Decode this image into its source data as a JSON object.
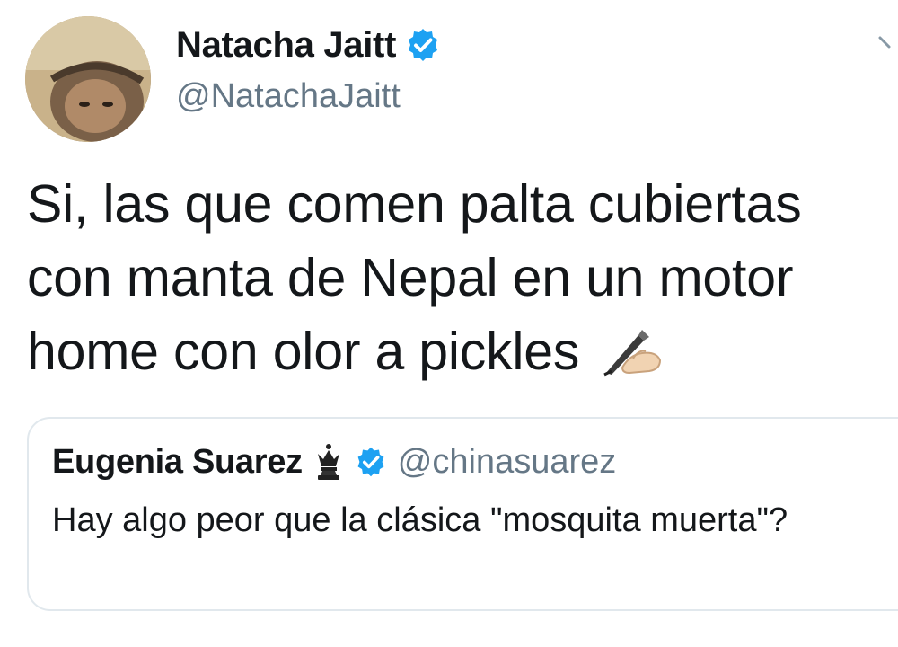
{
  "author": {
    "display_name": "Natacha Jaitt",
    "handle": "@NatachaJaitt",
    "verified": true
  },
  "tweet": {
    "text": "Si, las que comen palta cubiertas con manta de Nepal en un motor home con olor a pickles",
    "emoji": "writing-hand-icon"
  },
  "quoted_tweet": {
    "display_name": "Eugenia Suarez",
    "name_emoji": "chess-queen-icon",
    "verified": true,
    "handle": "@chinasuarez",
    "text": "Hay algo peor que la clásica \"mosquita muerta\"?"
  },
  "colors": {
    "verified_blue": "#1da1f2",
    "secondary_text": "#657786",
    "border": "#e1e8ed"
  }
}
